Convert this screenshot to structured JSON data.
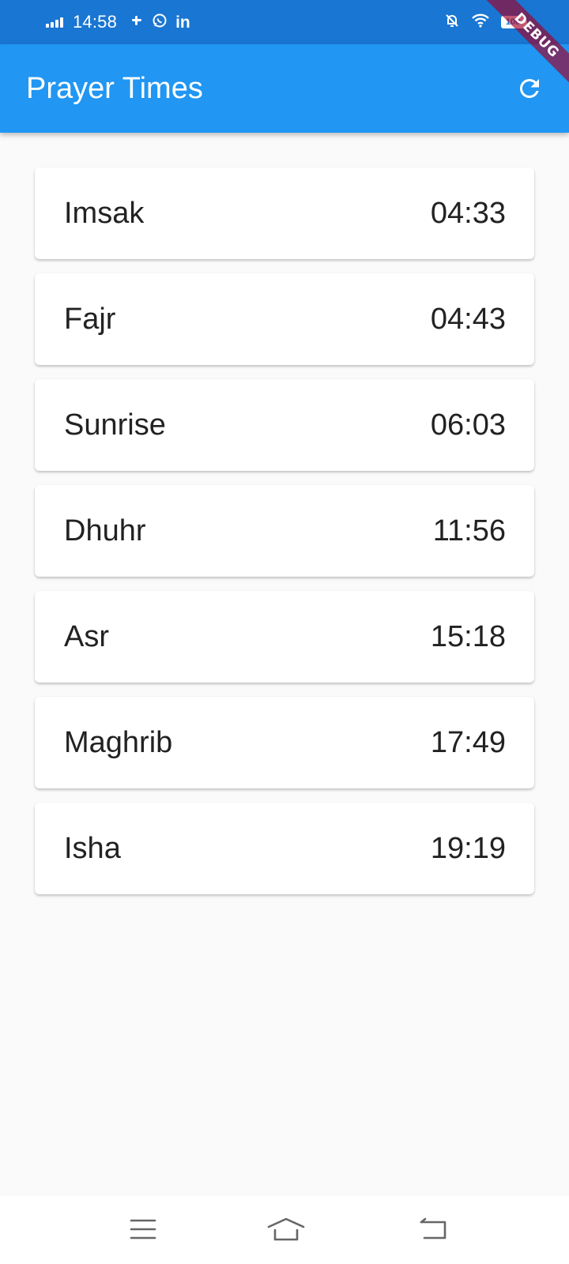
{
  "status_bar": {
    "time": "14:58",
    "icons": [
      "signal-icon",
      "slack-icon",
      "whatsapp-icon",
      "linkedin-icon",
      "mute-icon",
      "wifi-icon",
      "battery-icon"
    ],
    "battery": "100"
  },
  "debug_banner": "DEBUG",
  "app_bar": {
    "title": "Prayer Times",
    "action_icon": "refresh-icon"
  },
  "prayers": [
    {
      "name": "Imsak",
      "time": "04:33"
    },
    {
      "name": "Fajr",
      "time": "04:43"
    },
    {
      "name": "Sunrise",
      "time": "06:03"
    },
    {
      "name": "Dhuhr",
      "time": "11:56"
    },
    {
      "name": "Asr",
      "time": "15:18"
    },
    {
      "name": "Maghrib",
      "time": "17:49"
    },
    {
      "name": "Isha",
      "time": "19:19"
    }
  ],
  "nav_bar": {
    "buttons": [
      "menu-icon",
      "home-icon",
      "back-icon"
    ]
  },
  "colors": {
    "status_bar": "#1976d2",
    "app_bar": "#2196f3",
    "background": "#fafafa",
    "card": "#ffffff",
    "text": "#222222"
  }
}
